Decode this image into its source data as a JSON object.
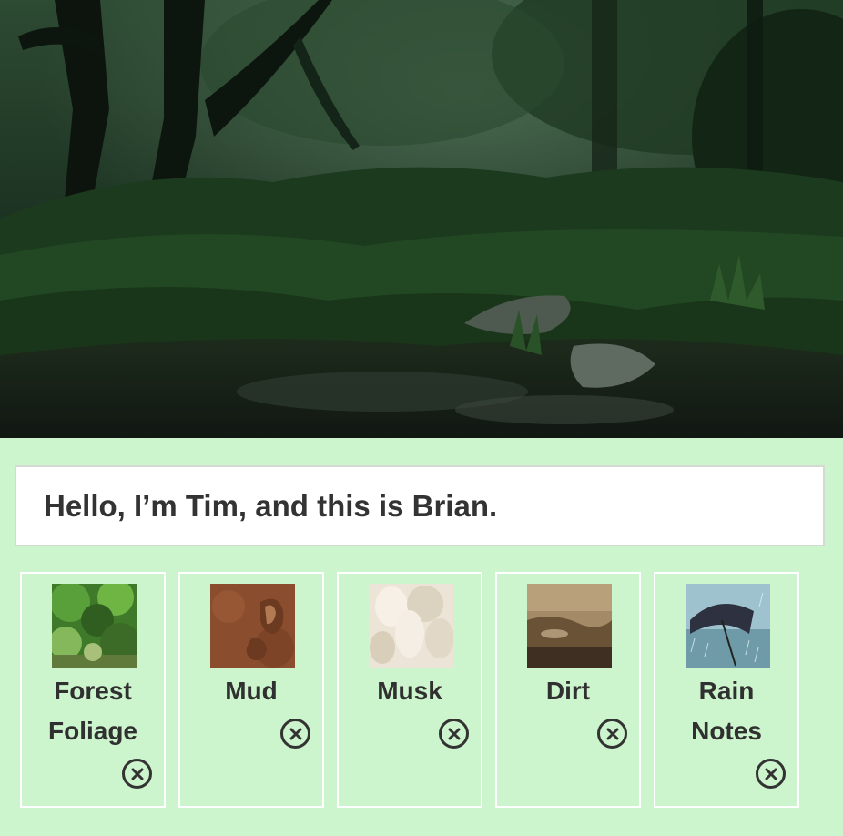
{
  "hero": {
    "image": "rainy-forest-photo"
  },
  "message": {
    "text": "Hello, I’m Tim, and this is Brian."
  },
  "cards": [
    {
      "label_line1": "Forest",
      "label_line2": "Foliage",
      "thumbnail": "foliage-photo",
      "remove_icon": "close-circle-icon"
    },
    {
      "label_line1": "Mud",
      "label_line2": "",
      "thumbnail": "mud-footprint-photo",
      "remove_icon": "close-circle-icon"
    },
    {
      "label_line1": "Musk",
      "label_line2": "",
      "thumbnail": "musk-photo",
      "remove_icon": "close-circle-icon"
    },
    {
      "label_line1": "Dirt",
      "label_line2": "",
      "thumbnail": "dirt-photo",
      "remove_icon": "close-circle-icon"
    },
    {
      "label_line1": "Rain",
      "label_line2": "Notes",
      "thumbnail": "rain-umbrella-photo",
      "remove_icon": "close-circle-icon"
    }
  ],
  "colors": {
    "background": "#cdf5cd",
    "card_border": "#ffffff",
    "text": "#303030"
  }
}
